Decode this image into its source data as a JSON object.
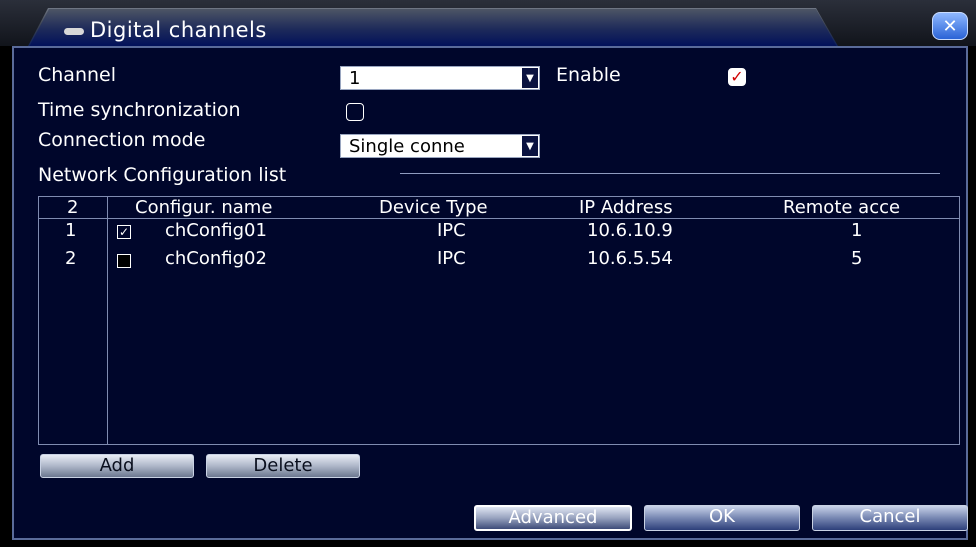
{
  "window": {
    "title": "Digital channels",
    "close_label": "×"
  },
  "form": {
    "channel_label": "Channel",
    "channel_value": "1",
    "enable_label": "Enable",
    "enable_checked": true,
    "time_sync_label": "Time synchronization",
    "time_sync_checked": false,
    "connection_mode_label": "Connection mode",
    "connection_mode_value": "Single conne",
    "network_list_label": "Network Configuration list"
  },
  "table": {
    "count_header": "2",
    "headers": [
      "Configur. name",
      "Device Type",
      "IP Address",
      "Remote acce"
    ],
    "rows": [
      {
        "index": "1",
        "checked": true,
        "name": "chConfig01",
        "device_type": "IPC",
        "ip": "10.6.10.9",
        "remote": "1"
      },
      {
        "index": "2",
        "checked": false,
        "name": "chConfig02",
        "device_type": "IPC",
        "ip": "10.6.5.54",
        "remote": "5"
      }
    ]
  },
  "buttons": {
    "add": "Add",
    "delete": "Delete",
    "advanced": "Advanced",
    "ok": "OK",
    "cancel": "Cancel"
  },
  "icons": {
    "close": "close-icon",
    "dropdown": "chevron-down-icon",
    "checkmark": "check-icon"
  },
  "colors": {
    "panel_bg": "#00062b",
    "title_accent": "#02115a",
    "enable_check": "#d10000"
  }
}
